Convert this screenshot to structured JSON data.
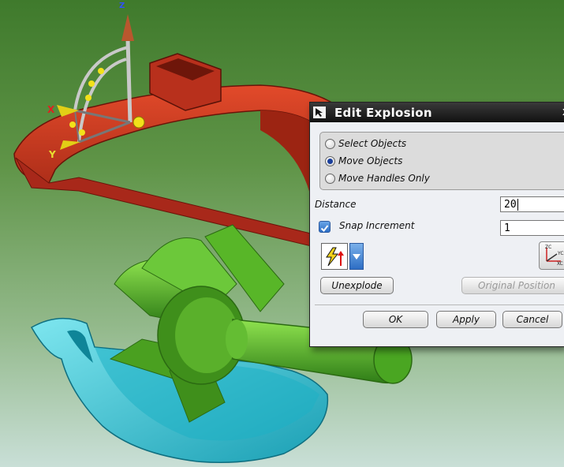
{
  "dialog": {
    "title": "Edit Explosion",
    "close_glyph": "x",
    "mode_options": [
      {
        "label": "Select Objects",
        "selected": false
      },
      {
        "label": "Move Objects",
        "selected": true
      },
      {
        "label": "Move Handles Only",
        "selected": false
      }
    ],
    "distance": {
      "label": "Distance",
      "value": "20"
    },
    "snap_increment": {
      "label": "Snap Increment",
      "checked": true,
      "value": "1"
    },
    "unexplode_label": "Unexplode",
    "original_position_label": "Original Position",
    "ok_label": "OK",
    "apply_label": "Apply",
    "cancel_label": "Cancel",
    "icons": {
      "title": "arrow-cursor-icon",
      "vector": "vector-lightning-icon",
      "dropdown": "chevron-down-icon",
      "csys": "csys-axes-icon"
    },
    "csys_axis_labels": {
      "z": "ZC",
      "y": "YC",
      "x": "XC"
    }
  },
  "scene": {
    "triad_labels": {
      "x": "X",
      "y": "Y",
      "z": "Z"
    },
    "colors": {
      "housing_top": "#c8321c",
      "housing_bottom": "#2fc4d6",
      "impeller": "#5bb62e",
      "triad": "#c9c9c9",
      "handle": "#f2e11a"
    }
  }
}
